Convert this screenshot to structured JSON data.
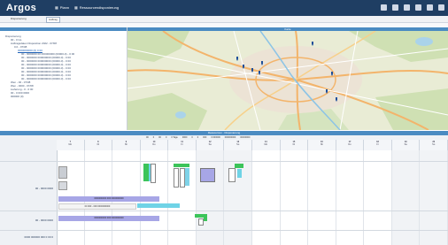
{
  "app": {
    "brand": "Argos",
    "nav": [
      {
        "label": "Plann",
        "icon": "calendar-icon"
      },
      {
        "label": "Ressourcendisponierung",
        "icon": "grid-icon"
      }
    ],
    "top_icons": [
      "monitor-icon",
      "refresh-icon",
      "settings-icon",
      "home-icon",
      "lock-icon",
      "gear-icon"
    ]
  },
  "tabs": [
    {
      "label": "Disponierung",
      "active": false
    },
    {
      "label": "Auftrag",
      "active": true
    }
  ],
  "tree": {
    "items": [
      "Disponierung",
      "00 - 0 GL",
      "Auftragsdaten Disposition 2022 - 07/08",
      "0.0 - 07/08",
      "0000000000 (0) 0 00",
      "00 - 0000000 00 000000000 (00000-0) - 0 00",
      "00 - 0000000 000000000 (00000-0) - 0 00",
      "00 - 0000000 000000000 (00000-0) - 0 00",
      "00 - 0000000 000000000 (00000-0) - 0 00",
      "00 - 0000000 000000000 (00000-0) - 0 00",
      "00 - 0000000 000000000 (00000-0) - 0 00",
      "00 - 0000000 000000000 (00000-0) - 0 00",
      "00 - 0000000 000000000 (00000-0) - 0 00",
      "Wen - 00 - 07/08",
      "Wen - 0000 - 07/08",
      "Lieferung - 0 - 0 00",
      "00 - 0 000 0000",
      "000000 (0)"
    ]
  },
  "map": {
    "header": "Karte",
    "markers": 9
  },
  "midbar": "Ressourcen · Disponierung",
  "gantt_options": [
    "00",
    "0",
    "00",
    "0",
    "0 Tage",
    "0000",
    "0",
    "0",
    "000",
    "0 000000",
    "000000000",
    "00000000"
  ],
  "days": [
    {
      "n": "7",
      "d": "Mo"
    },
    {
      "n": "8",
      "d": "Di"
    },
    {
      "n": "9",
      "d": "Mi"
    },
    {
      "n": "10",
      "d": "Do"
    },
    {
      "n": "11",
      "d": "Fr"
    },
    {
      "n": "12",
      "d": "Sa"
    },
    {
      "n": "13",
      "d": "So"
    },
    {
      "n": "14",
      "d": "Mo"
    },
    {
      "n": "15",
      "d": "Di"
    },
    {
      "n": "16",
      "d": "Mi"
    },
    {
      "n": "17",
      "d": "Do"
    },
    {
      "n": "18",
      "d": "Fr"
    },
    {
      "n": "19",
      "d": "Sa"
    },
    {
      "n": "20",
      "d": "So"
    }
  ],
  "rows": [
    {
      "label": "00 - 0000 0000"
    },
    {
      "label": "00 - 0000 0000"
    },
    {
      "label": "0000 000000 000 0 00 0"
    }
  ],
  "bars": {
    "row1_bar1": "0000000000 000 0000000000",
    "row1_bar2": "00 000 - 000 0000000000",
    "row2_bar1": "0000000000 000 0000000000"
  },
  "colors": {
    "topbar": "#1f3e63",
    "accent": "#4a8bc2",
    "green": "#3cc45a",
    "cyan": "#6fd3e6",
    "violet": "#a7a6e6"
  }
}
